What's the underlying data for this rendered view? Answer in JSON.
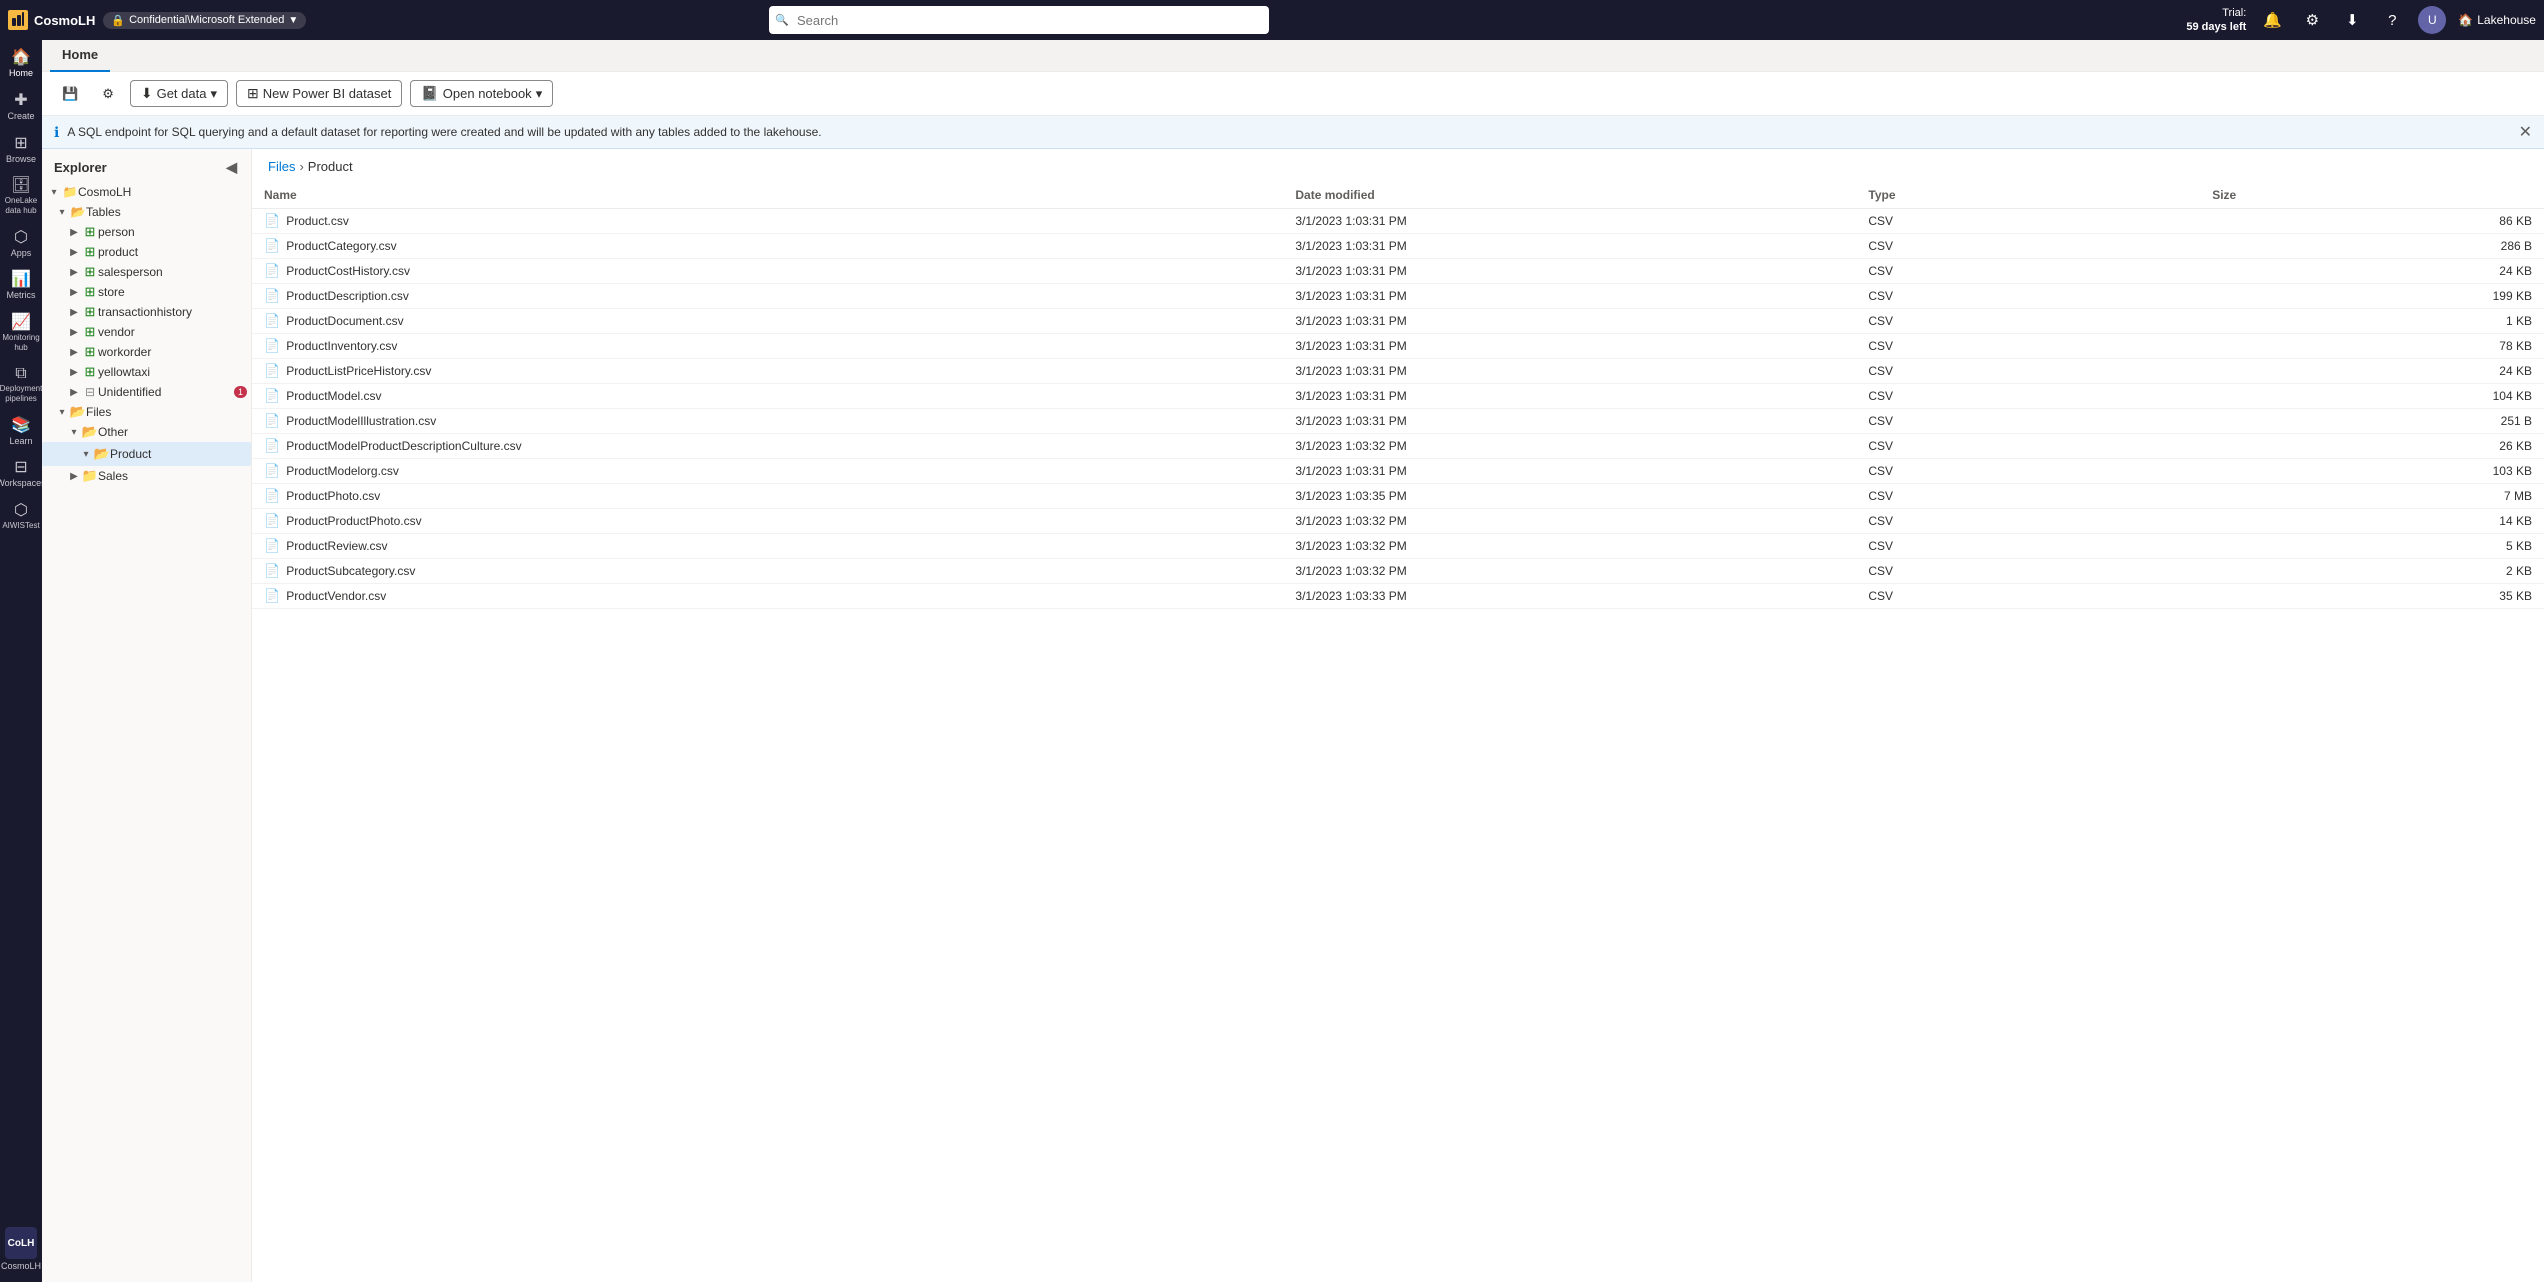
{
  "app": {
    "name": "CosmoLH",
    "workspace": "Confidential\\Microsoft Extended",
    "lakehouse_label": "Lakehouse"
  },
  "trial": {
    "label": "Trial:",
    "days": "59 days left"
  },
  "search": {
    "placeholder": "Search"
  },
  "tabs": [
    {
      "id": "home",
      "label": "Home",
      "active": true
    }
  ],
  "toolbar": {
    "get_data": "Get data",
    "new_power_bi_dataset": "New Power BI dataset",
    "open_notebook": "Open notebook"
  },
  "info_bar": {
    "message": "A SQL endpoint for SQL querying and a default dataset for reporting were created and will be updated with any tables added to the lakehouse."
  },
  "explorer": {
    "title": "Explorer",
    "workspace": "CosmoLH",
    "tables": {
      "label": "Tables",
      "items": [
        {
          "id": "person",
          "label": "person",
          "type": "table"
        },
        {
          "id": "product",
          "label": "product",
          "type": "table"
        },
        {
          "id": "salesperson",
          "label": "salesperson",
          "type": "table"
        },
        {
          "id": "store",
          "label": "store",
          "type": "table"
        },
        {
          "id": "transactionhistory",
          "label": "transactionhistory",
          "type": "table"
        },
        {
          "id": "vendor",
          "label": "vendor",
          "type": "table"
        },
        {
          "id": "workorder",
          "label": "workorder",
          "type": "table"
        },
        {
          "id": "yellowtaxi",
          "label": "yellowtaxi",
          "type": "table"
        },
        {
          "id": "unidentified",
          "label": "Unidentified",
          "type": "unidentified",
          "badge": "1"
        }
      ]
    },
    "files": {
      "label": "Files",
      "items": [
        {
          "id": "other",
          "label": "Other",
          "type": "folder",
          "expanded": true,
          "children": [
            {
              "id": "product-folder",
              "label": "Product",
              "type": "folder",
              "selected": true
            }
          ]
        },
        {
          "id": "sales",
          "label": "Sales",
          "type": "folder"
        }
      ]
    }
  },
  "breadcrumb": {
    "items": [
      {
        "label": "Files",
        "link": true
      },
      {
        "label": "Product",
        "link": false
      }
    ]
  },
  "file_table": {
    "columns": [
      {
        "id": "name",
        "label": "Name"
      },
      {
        "id": "date_modified",
        "label": "Date modified"
      },
      {
        "id": "type",
        "label": "Type"
      },
      {
        "id": "size",
        "label": "Size"
      }
    ],
    "rows": [
      {
        "name": "Product.csv",
        "date_modified": "3/1/2023 1:03:31 PM",
        "type": "CSV",
        "size": "86 KB"
      },
      {
        "name": "ProductCategory.csv",
        "date_modified": "3/1/2023 1:03:31 PM",
        "type": "CSV",
        "size": "286 B"
      },
      {
        "name": "ProductCostHistory.csv",
        "date_modified": "3/1/2023 1:03:31 PM",
        "type": "CSV",
        "size": "24 KB"
      },
      {
        "name": "ProductDescription.csv",
        "date_modified": "3/1/2023 1:03:31 PM",
        "type": "CSV",
        "size": "199 KB"
      },
      {
        "name": "ProductDocument.csv",
        "date_modified": "3/1/2023 1:03:31 PM",
        "type": "CSV",
        "size": "1 KB"
      },
      {
        "name": "ProductInventory.csv",
        "date_modified": "3/1/2023 1:03:31 PM",
        "type": "CSV",
        "size": "78 KB"
      },
      {
        "name": "ProductListPriceHistory.csv",
        "date_modified": "3/1/2023 1:03:31 PM",
        "type": "CSV",
        "size": "24 KB"
      },
      {
        "name": "ProductModel.csv",
        "date_modified": "3/1/2023 1:03:31 PM",
        "type": "CSV",
        "size": "104 KB"
      },
      {
        "name": "ProductModelIllustration.csv",
        "date_modified": "3/1/2023 1:03:31 PM",
        "type": "CSV",
        "size": "251 B"
      },
      {
        "name": "ProductModelProductDescriptionCulture.csv",
        "date_modified": "3/1/2023 1:03:32 PM",
        "type": "CSV",
        "size": "26 KB"
      },
      {
        "name": "ProductModelorg.csv",
        "date_modified": "3/1/2023 1:03:31 PM",
        "type": "CSV",
        "size": "103 KB"
      },
      {
        "name": "ProductPhoto.csv",
        "date_modified": "3/1/2023 1:03:35 PM",
        "type": "CSV",
        "size": "7 MB"
      },
      {
        "name": "ProductProductPhoto.csv",
        "date_modified": "3/1/2023 1:03:32 PM",
        "type": "CSV",
        "size": "14 KB"
      },
      {
        "name": "ProductReview.csv",
        "date_modified": "3/1/2023 1:03:32 PM",
        "type": "CSV",
        "size": "5 KB"
      },
      {
        "name": "ProductSubcategory.csv",
        "date_modified": "3/1/2023 1:03:32 PM",
        "type": "CSV",
        "size": "2 KB"
      },
      {
        "name": "ProductVendor.csv",
        "date_modified": "3/1/2023 1:03:33 PM",
        "type": "CSV",
        "size": "35 KB"
      }
    ]
  },
  "nav": {
    "items": [
      {
        "id": "home",
        "icon": "🏠",
        "label": "Home"
      },
      {
        "id": "create",
        "icon": "✚",
        "label": "Create"
      },
      {
        "id": "browse",
        "icon": "⊞",
        "label": "Browse"
      },
      {
        "id": "onelake",
        "icon": "🗄",
        "label": "OneLake data hub"
      },
      {
        "id": "apps",
        "icon": "⬡",
        "label": "Apps"
      },
      {
        "id": "metrics",
        "icon": "📊",
        "label": "Metrics"
      },
      {
        "id": "monitoring",
        "icon": "📈",
        "label": "Monitoring hub"
      },
      {
        "id": "deployment",
        "icon": "⬡",
        "label": "Deployment pipelines"
      },
      {
        "id": "learn",
        "icon": "📚",
        "label": "Learn"
      },
      {
        "id": "workspaces",
        "icon": "⬡",
        "label": "Workspaces"
      },
      {
        "id": "aitest",
        "icon": "⬡",
        "label": "AIWISTest"
      }
    ]
  }
}
